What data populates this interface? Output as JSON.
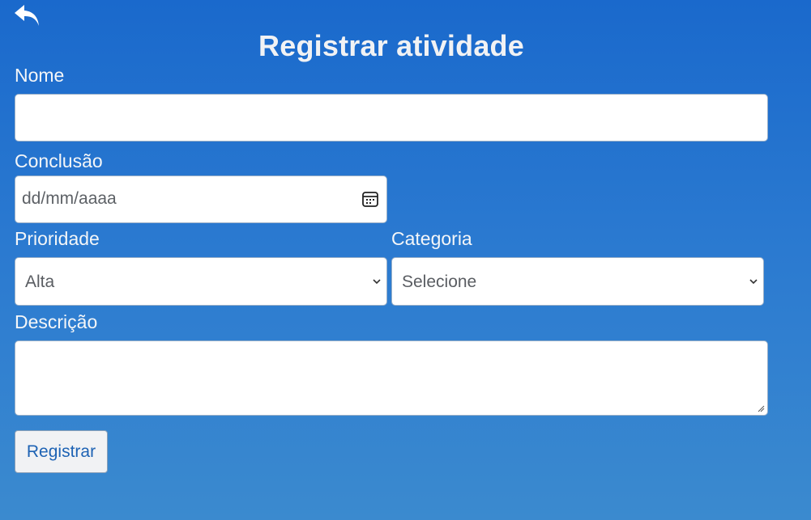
{
  "header": {
    "back_icon": "back-arrow-icon",
    "title": "Registrar atividade"
  },
  "form": {
    "nome_label": "Nome",
    "nome_value": "",
    "conclusao_label": "Conclusão",
    "conclusao_placeholder": "dd/mm/aaaa",
    "conclusao_icon": "calendar-icon",
    "prioridade_label": "Prioridade",
    "prioridade_value": "Alta",
    "categoria_label": "Categoria",
    "categoria_value": "Selecione",
    "descricao_label": "Descrição",
    "descricao_value": "",
    "submit_label": "Registrar"
  },
  "colors": {
    "background_top": "#1a69cc",
    "background_bottom": "#3b8acf",
    "button_text": "#1e63b4"
  }
}
